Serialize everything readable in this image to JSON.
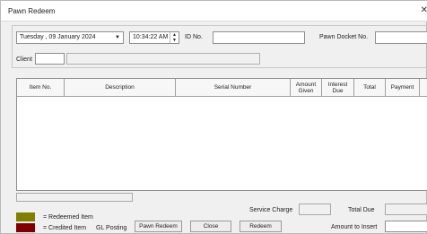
{
  "window": {
    "title": "Pawn Redeem"
  },
  "header": {
    "date_value": "Tuesday  , 09  January  2024",
    "time_value": "10:34:22 AM",
    "id_no_label": "ID No.",
    "id_no_value": "",
    "pawn_docket_label": "Pawn Docket No.",
    "pawn_docket_value": "",
    "client_label": "Client",
    "client_code_value": "",
    "client_name_value": ""
  },
  "grid": {
    "columns": [
      {
        "label": "Item No."
      },
      {
        "label": "Description"
      },
      {
        "label": "Serial Number"
      },
      {
        "label": "Amount\nGiven"
      },
      {
        "label": "Interest\nDue"
      },
      {
        "label": "Total"
      },
      {
        "label": "Payment"
      },
      {
        "label": ""
      }
    ],
    "rows": []
  },
  "footer": {
    "status_value": "",
    "legend": [
      {
        "label": "= Redeemed Item",
        "color": "#808000"
      },
      {
        "label": "= Credited Item",
        "color": "#800000"
      }
    ],
    "gl_posting_label": "GL Posting",
    "pawn_redeem_button": "Pawn Redeem",
    "close_button": "Close",
    "redeem_button": "Redeem",
    "service_charge_label": "Service Charge",
    "service_charge_value": "",
    "total_due_label": "Total Due",
    "total_due_value": "",
    "amount_to_insert_label": "Amount to Insert",
    "amount_to_insert_value": ""
  }
}
